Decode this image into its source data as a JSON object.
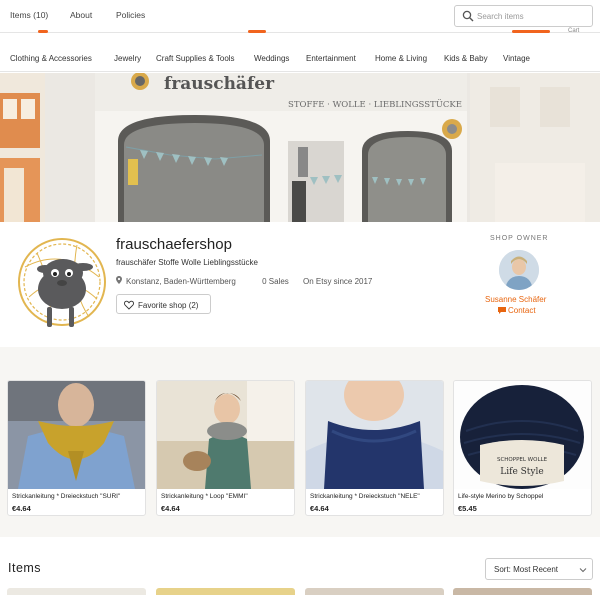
{
  "topnav": {
    "items_link": "Items (10)",
    "about_link": "About",
    "policies_link": "Policies",
    "search_placeholder": "Search items",
    "cart_hint": "Cart"
  },
  "categories": [
    "Clothing & Accessories",
    "Jewelry",
    "Craft Supplies & Tools",
    "Weddings",
    "Entertainment",
    "Home & Living",
    "Kids & Baby",
    "Vintage"
  ],
  "banner": {
    "sign_brand": "frauschäfer",
    "sign_text": "STOFFE · WOLLE · LIEBLINGSSTÜCKE"
  },
  "shop": {
    "name": "frauschaefershop",
    "tagline": "frauschäfer Stoffe Wolle Lieblingsstücke",
    "location": "Konstanz, Baden-Württemberg",
    "sales": "0 Sales",
    "since": "On Etsy since 2017",
    "favorite_label": "Favorite shop (2)"
  },
  "owner": {
    "heading": "SHOP OWNER",
    "name": "Susanne Schäfer",
    "contact_label": "Contact"
  },
  "featured": [
    {
      "title": "Strickanleitung * Dreieckstuch \"SURI\"",
      "price": "€4.64"
    },
    {
      "title": "Strickanleitung * Loop \"EMMI\"",
      "price": "€4.64"
    },
    {
      "title": "Strickanleitung * Dreieckstuch \"NELE\"",
      "price": "€4.64"
    },
    {
      "title": "Life-style Merino by Schoppel",
      "price": "€5.45"
    }
  ],
  "yarn_label": {
    "brand": "SCHOPPEL WOLLE",
    "line": "Life Style"
  },
  "items_section": {
    "heading": "Items",
    "sort_label": "Sort: Most Recent"
  },
  "colors": {
    "accent": "#f1641e",
    "owner_link": "#e8650f",
    "featured_bg": "#f7f6f3"
  }
}
